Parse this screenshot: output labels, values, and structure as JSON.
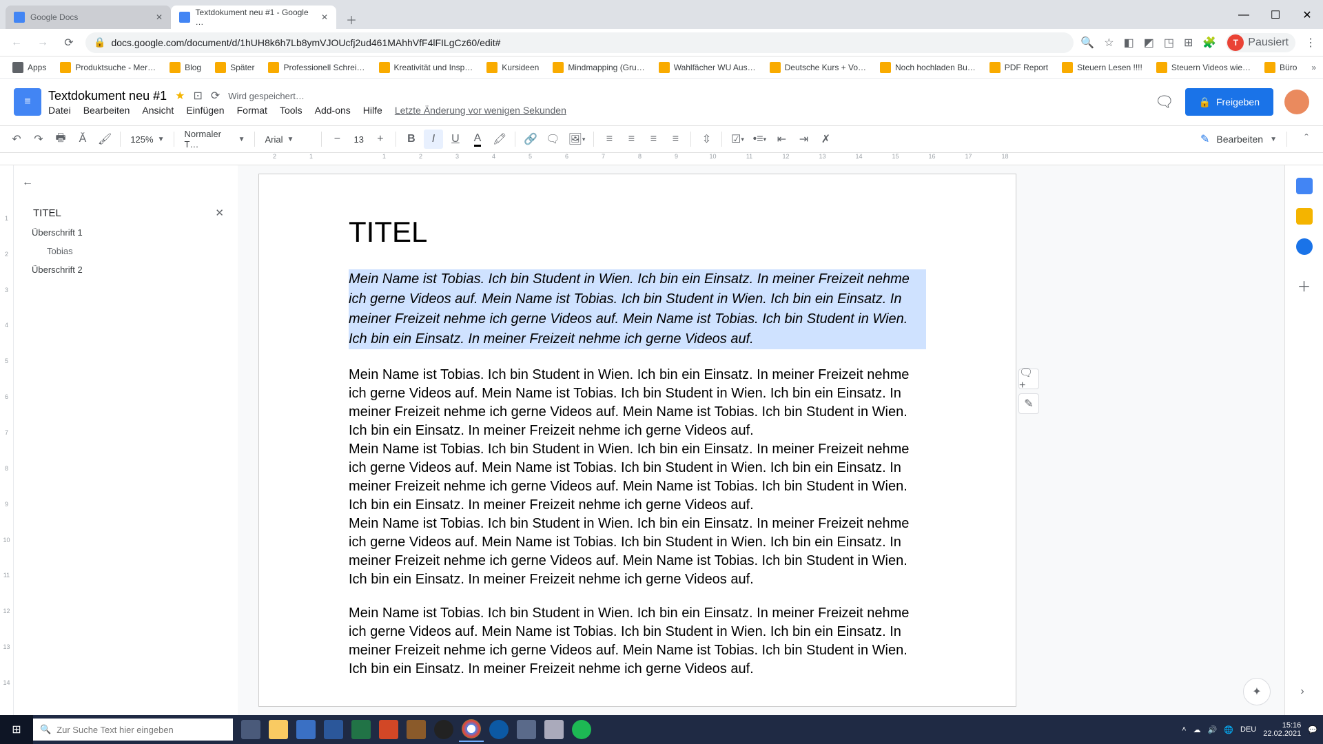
{
  "chrome": {
    "tabs": [
      {
        "label": "Google Docs"
      },
      {
        "label": "Textdokument neu #1 - Google …"
      }
    ],
    "url": "docs.google.com/document/d/1hUH8k6h7Lb8ymVJOUcfj2ud461MAhhVfF4lFILgCz60/edit#",
    "paused": "Pausiert",
    "profile_initial": "T",
    "bookmarks": [
      "Apps",
      "Produktsuche - Mer…",
      "Blog",
      "Später",
      "Professionell Schrei…",
      "Kreativität und Insp…",
      "Kursideen",
      "Mindmapping (Gru…",
      "Wahlfächer WU Aus…",
      "Deutsche Kurs + Vo…",
      "Noch hochladen Bu…",
      "PDF Report",
      "Steuern Lesen !!!!",
      "Steuern Videos wie…",
      "Büro"
    ]
  },
  "docs": {
    "title": "Textdokument neu #1",
    "saving": "Wird gespeichert…",
    "menus": [
      "Datei",
      "Bearbeiten",
      "Ansicht",
      "Einfügen",
      "Format",
      "Tools",
      "Add-ons",
      "Hilfe"
    ],
    "last_mod": "Letzte Änderung vor wenigen Sekunden",
    "share": "Freigeben",
    "zoom": "125%",
    "style": "Normaler T…",
    "font": "Arial",
    "size": "13",
    "edit_mode": "Bearbeiten"
  },
  "ruler_h": [
    "2",
    "1",
    "",
    "1",
    "2",
    "3",
    "4",
    "5",
    "6",
    "7",
    "8",
    "9",
    "10",
    "11",
    "12",
    "13",
    "14",
    "15",
    "16",
    "17",
    "18"
  ],
  "ruler_v": [
    "",
    "1",
    "2",
    "3",
    "4",
    "5",
    "6",
    "7",
    "8",
    "9",
    "10",
    "11",
    "12",
    "13",
    "14"
  ],
  "outline": {
    "items": [
      {
        "label": "TITEL",
        "cls": "title",
        "close": true
      },
      {
        "label": "Überschrift 1",
        "cls": "h1"
      },
      {
        "label": "Tobias",
        "cls": "h2"
      },
      {
        "label": "Überschrift 2",
        "cls": "h1b"
      }
    ]
  },
  "doc": {
    "title_text": "TITEL",
    "selected_para": "Mein Name ist Tobias. Ich bin Student in Wien. Ich bin ein Einsatz. In meiner Freizeit nehme ich gerne Videos auf. Mein Name ist Tobias. Ich bin Student in Wien. Ich bin ein Einsatz. In meiner Freizeit nehme ich gerne Videos auf. Mein Name ist Tobias. Ich bin Student in Wien. Ich bin ein Einsatz. In meiner Freizeit nehme ich gerne Videos auf.",
    "para1": "Mein Name ist Tobias. Ich bin Student in Wien. Ich bin ein Einsatz. In meiner Freizeit nehme ich gerne Videos auf. Mein Name ist Tobias. Ich bin Student in Wien. Ich bin ein Einsatz. In meiner Freizeit nehme ich gerne Videos auf. Mein Name ist Tobias. Ich bin Student in Wien. Ich bin ein Einsatz. In meiner Freizeit nehme ich gerne Videos auf.",
    "para2": "Mein Name ist Tobias. Ich bin Student in Wien. Ich bin ein Einsatz. In meiner Freizeit nehme ich gerne Videos auf. Mein Name ist Tobias. Ich bin Student in Wien. Ich bin ein Einsatz. In meiner Freizeit nehme ich gerne Videos auf. Mein Name ist Tobias. Ich bin Student in Wien. Ich bin ein Einsatz. In meiner Freizeit nehme ich gerne Videos auf.",
    "para3": "Mein Name ist Tobias. Ich bin Student in Wien. Ich bin ein Einsatz. In meiner Freizeit nehme ich gerne Videos auf. Mein Name ist Tobias. Ich bin Student in Wien. Ich bin ein Einsatz. In meiner Freizeit nehme ich gerne Videos auf. Mein Name ist Tobias. Ich bin Student in Wien. Ich bin ein Einsatz. In meiner Freizeit nehme ich gerne Videos auf.",
    "para4": "Mein Name ist Tobias. Ich bin Student in Wien. Ich bin ein Einsatz. In meiner Freizeit nehme ich gerne Videos auf. Mein Name ist Tobias. Ich bin Student in Wien. Ich bin ein Einsatz. In meiner Freizeit nehme ich gerne Videos auf. Mein Name ist Tobias. Ich bin Student in Wien. Ich bin ein Einsatz. In meiner Freizeit nehme ich gerne Videos auf."
  },
  "taskbar": {
    "search_placeholder": "Zur Suche Text hier eingeben",
    "time": "15:16",
    "date": "22.02.2021",
    "lang": "DEU"
  }
}
